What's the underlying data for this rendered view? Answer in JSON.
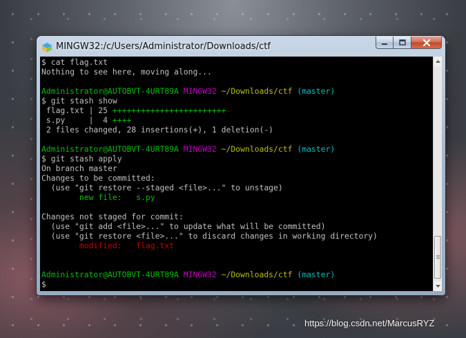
{
  "window": {
    "title": "MINGW32:/c/Users/Administrator/Downloads/ctf"
  },
  "colors": {
    "green": "#00bf00",
    "magenta": "#bf00bf",
    "yellow": "#bfbf00",
    "cyan": "#00bfbf",
    "red": "#bf0000",
    "default": "#c0c0c0",
    "background": "#000000"
  },
  "terminal": {
    "lines": [
      [
        {
          "t": "$ cat flag.txt",
          "c": "white"
        }
      ],
      [
        {
          "t": "Nothing to see here, moving along...",
          "c": "white"
        }
      ],
      [],
      [
        {
          "t": "Administrator@AUTOBVT-4URT89A ",
          "c": "green"
        },
        {
          "t": "MINGW32 ",
          "c": "magenta"
        },
        {
          "t": "~/Downloads/ctf ",
          "c": "yellow"
        },
        {
          "t": "(master)",
          "c": "cyan"
        }
      ],
      [
        {
          "t": "$ git stash show",
          "c": "white"
        }
      ],
      [
        {
          "t": " flag.txt | 25 ",
          "c": "white"
        },
        {
          "t": "++++++++++++++++++++++++",
          "c": "green"
        },
        {
          "t": "-",
          "c": "red"
        }
      ],
      [
        {
          "t": " s.py     |  4 ",
          "c": "white"
        },
        {
          "t": "++++",
          "c": "green"
        }
      ],
      [
        {
          "t": " 2 files changed, 28 insertions(+), 1 deletion(-)",
          "c": "white"
        }
      ],
      [],
      [
        {
          "t": "Administrator@AUTOBVT-4URT89A ",
          "c": "green"
        },
        {
          "t": "MINGW32 ",
          "c": "magenta"
        },
        {
          "t": "~/Downloads/ctf ",
          "c": "yellow"
        },
        {
          "t": "(master)",
          "c": "cyan"
        }
      ],
      [
        {
          "t": "$ git stash apply",
          "c": "white"
        }
      ],
      [
        {
          "t": "On branch master",
          "c": "white"
        }
      ],
      [
        {
          "t": "Changes to be committed:",
          "c": "white"
        }
      ],
      [
        {
          "t": "  (use \"git restore --staged <file>...\" to unstage)",
          "c": "white"
        }
      ],
      [
        {
          "t": "        new file:   s.py",
          "c": "green"
        }
      ],
      [],
      [
        {
          "t": "Changes not staged for commit:",
          "c": "white"
        }
      ],
      [
        {
          "t": "  (use \"git add <file>...\" to update what will be committed)",
          "c": "white"
        }
      ],
      [
        {
          "t": "  (use \"git restore <file>...\" to discard changes in working directory)",
          "c": "white"
        }
      ],
      [
        {
          "t": "        modified:   flag.txt",
          "c": "red"
        }
      ],
      [],
      [],
      [
        {
          "t": "Administrator@AUTOBVT-4URT89A ",
          "c": "green"
        },
        {
          "t": "MINGW32 ",
          "c": "magenta"
        },
        {
          "t": "~/Downloads/ctf ",
          "c": "yellow"
        },
        {
          "t": "(master)",
          "c": "cyan"
        }
      ],
      [
        {
          "t": "$",
          "c": "white"
        }
      ]
    ]
  },
  "watermark": "https://blog.csdn.net/MarcusRYZ"
}
